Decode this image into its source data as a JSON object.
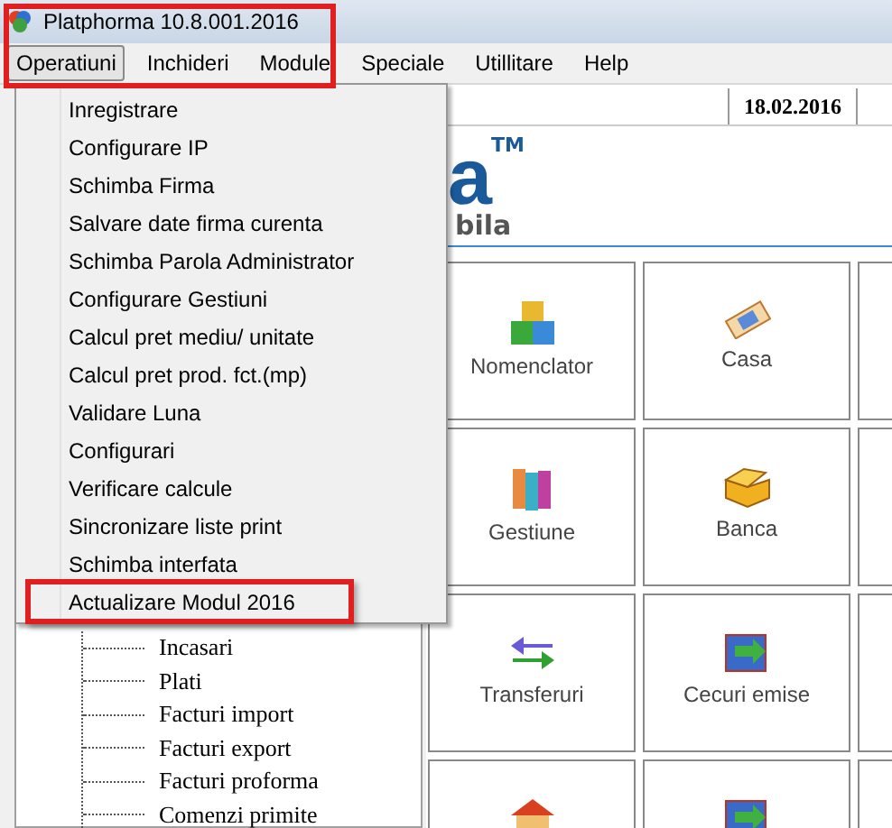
{
  "window": {
    "title": "Platphorma 10.8.001.2016",
    "highlighted": true
  },
  "menubar": [
    {
      "label": "Operatiuni",
      "selected": true
    },
    {
      "label": "Inchideri",
      "selected": false
    },
    {
      "label": "Module",
      "selected": false
    },
    {
      "label": "Speciale",
      "selected": false
    },
    {
      "label": "Utillitare",
      "selected": false
    },
    {
      "label": "Help",
      "selected": false
    }
  ],
  "date": "18.02.2016",
  "logo": {
    "text": "a",
    "mark": "TM",
    "subtitle": "bila"
  },
  "tree": [
    "Incasari",
    "Plati",
    "Facturi import",
    "Facturi export",
    "Facturi proforma",
    "Comenzi primite"
  ],
  "tiles": [
    {
      "label": "Nomenclator",
      "kind": "blocks"
    },
    {
      "label": "Casa",
      "kind": "money"
    },
    {
      "kind": "blank"
    },
    {
      "label": "Gestiune",
      "kind": "books"
    },
    {
      "label": "Banca",
      "kind": "box"
    },
    {
      "kind": "blank"
    },
    {
      "label": "Transferuri",
      "kind": "arrows"
    },
    {
      "label": "Cecuri emise",
      "kind": "cheque"
    },
    {
      "kind": "blank"
    },
    {
      "kind": "house"
    },
    {
      "kind": "cheque"
    },
    {
      "kind": "blank"
    }
  ],
  "menu": {
    "items": [
      {
        "label": "Inregistrare",
        "highlighted": false
      },
      {
        "label": "Configurare IP",
        "highlighted": false
      },
      {
        "label": "Schimba Firma",
        "highlighted": false
      },
      {
        "label": "Salvare date firma curenta",
        "highlighted": false
      },
      {
        "label": "Schimba Parola Administrator",
        "highlighted": false
      },
      {
        "label": "Configurare Gestiuni",
        "highlighted": false
      },
      {
        "label": "Calcul pret mediu/ unitate",
        "highlighted": false
      },
      {
        "label": "Calcul pret prod. fct.(mp)",
        "highlighted": false
      },
      {
        "label": "Validare Luna",
        "highlighted": false
      },
      {
        "label": "Configurari",
        "highlighted": false
      },
      {
        "label": "Verificare calcule",
        "highlighted": false
      },
      {
        "label": "Sincronizare liste print",
        "highlighted": false
      },
      {
        "label": "Schimba interfata",
        "highlighted": false
      },
      {
        "label": "Actualizare Modul 2016",
        "highlighted": true
      }
    ]
  }
}
